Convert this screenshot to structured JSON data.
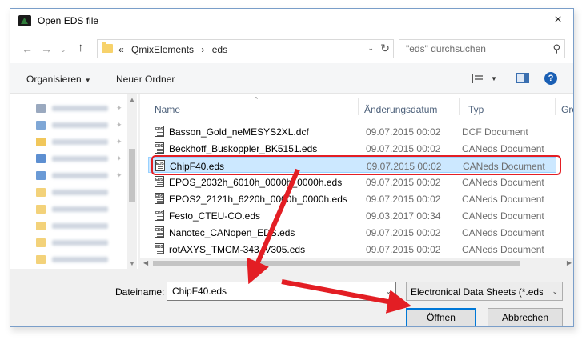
{
  "window": {
    "title": "Open EDS file",
    "close_icon": "×"
  },
  "navigation": {
    "back_icon": "←",
    "forward_icon": "→",
    "history_dropdown_icon": "⌄",
    "up_icon": "↑",
    "breadcrumb": [
      "«",
      "QmixElements",
      "›",
      "eds"
    ],
    "refresh_icon": "↻",
    "search_placeholder": "\"eds\" durchsuchen",
    "search_icon": "⚲"
  },
  "toolbar": {
    "organize_label": "Organisieren",
    "organize_dd": "▼",
    "new_folder_label": "Neuer Ordner",
    "view_dd": "▼",
    "help_label": "?"
  },
  "columns": {
    "sort_indicator": "^",
    "name": "Name",
    "date": "Änderungsdatum",
    "type": "Typ",
    "size": "Grö"
  },
  "files": [
    {
      "name": "Basson_Gold_neMESYS2XL.dcf",
      "date": "09.07.2015 00:02",
      "type": "DCF Document"
    },
    {
      "name": "Beckhoff_Buskoppler_BK5151.eds",
      "date": "09.07.2015 00:02",
      "type": "CANeds Document"
    },
    {
      "name": "ChipF40.eds",
      "date": "09.07.2015 00:02",
      "type": "CANeds Document"
    },
    {
      "name": "EPOS_2032h_6010h_0000h_0000h.eds",
      "date": "09.07.2015 00:02",
      "type": "CANeds Document"
    },
    {
      "name": "EPOS2_2121h_6220h_0000h_0000h.eds",
      "date": "09.07.2015 00:02",
      "type": "CANeds Document"
    },
    {
      "name": "Festo_CTEU-CO.eds",
      "date": "09.03.2017 00:34",
      "type": "CANeds Document"
    },
    {
      "name": "Nanotec_CANopen_EDS.eds",
      "date": "09.07.2015 00:02",
      "type": "CANeds Document"
    },
    {
      "name": "rotAXYS_TMCM-343_V305.eds",
      "date": "09.07.2015 00:02",
      "type": "CANeds Document"
    }
  ],
  "selected_file_index": 2,
  "scroll": {
    "up": "▲",
    "down": "▼",
    "left": "◀",
    "right": "▶"
  },
  "bottom": {
    "filename_label": "Dateiname:",
    "filename_value": "ChipF40.eds",
    "filename_dd": "⌄",
    "filter_value": "Electronical Data Sheets (*.eds *",
    "filter_dd": "⌄",
    "open_label": "Öffnen",
    "cancel_label": "Abbrechen"
  },
  "colors": {
    "annotation": "#e31e24",
    "selection": "#cce8ff",
    "accent": "#0078d7"
  }
}
